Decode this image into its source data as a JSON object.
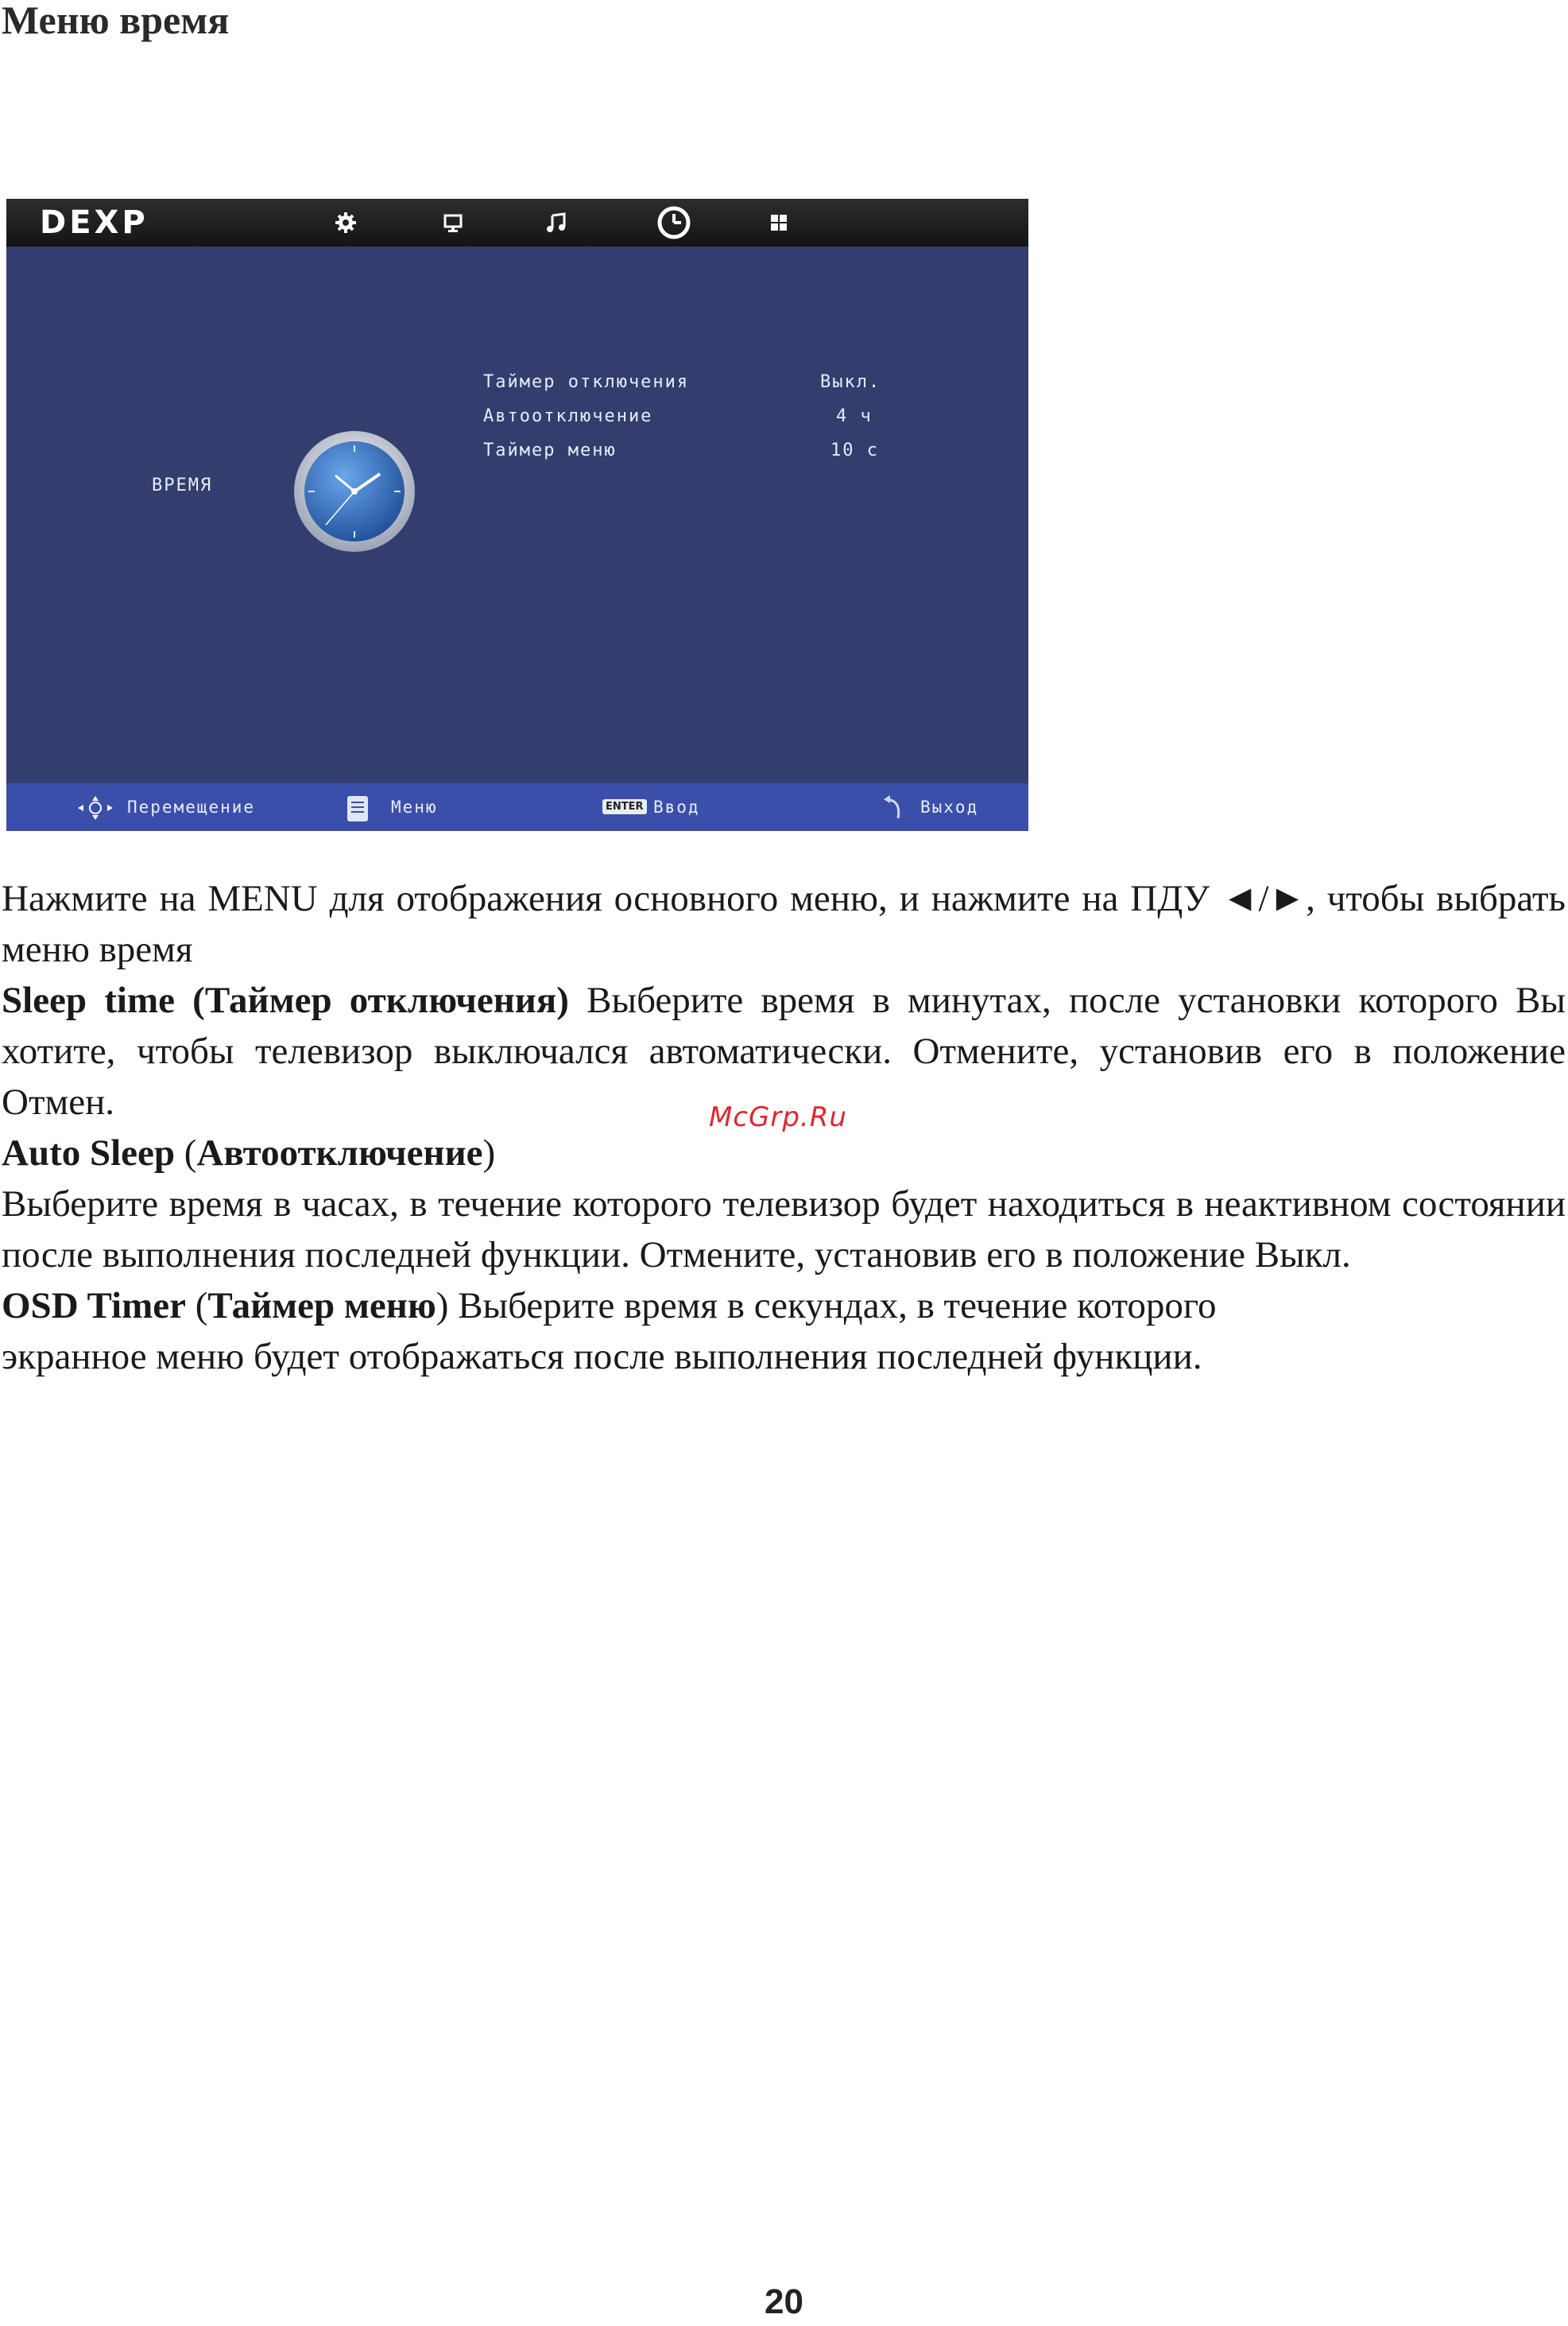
{
  "page": {
    "title": "Меню время",
    "number": "20",
    "watermark": "McGrp.Ru"
  },
  "tv_menu": {
    "brand": "DEXP",
    "tabs": [
      {
        "icon": "gear-icon"
      },
      {
        "icon": "monitor-icon"
      },
      {
        "icon": "music-note-icon"
      },
      {
        "icon": "clock-icon",
        "selected": true
      },
      {
        "icon": "grid-icon"
      }
    ],
    "section_label": "ВРЕМЯ",
    "settings": [
      {
        "label": "Таймер отключения",
        "value": "Выкл."
      },
      {
        "label": "Автоотключение",
        "value": "4 ч"
      },
      {
        "label": "Таймер меню",
        "value": "10 с"
      }
    ],
    "hints": {
      "move": "Перемещение",
      "menu": "Меню",
      "enter_key": "ENTER",
      "enter": "Ввод",
      "exit": "Выход"
    },
    "colors": {
      "background": "#333e6e",
      "bottom_bar": "#3a4fa9",
      "top_bar": "#1c1c1e"
    }
  },
  "doc": {
    "intro": "Нажмите на MENU для отображения основного меню, и нажмите на ПДУ ◄/►, чтобы выбрать меню время",
    "sleep_time": {
      "title": "Sleep time (Таймер отключения)",
      "text": " Выберите время в минутах, после установки которого Вы хотите, чтобы телевизор выключался автоматически. Отмените, установив его в положение Отмен."
    },
    "auto_sleep": {
      "title_en": "Auto Sleep",
      "open": " (",
      "title_ru": "Автоотключение",
      "close": ")",
      "text": "Выберите время в часах, в течение которого телевизор будет находиться в неактивном состоянии после выполнения последней функции. Отмените, установив его в положение Выкл."
    },
    "osd_timer": {
      "title_en": "OSD Timer",
      "open": " (",
      "title_ru": "Таймер меню",
      "close": ")",
      "text_line1": " Выберите время в секундах, в течение которого",
      "text_line2": "экранное меню будет отображаться после выполнения последней функции."
    }
  }
}
